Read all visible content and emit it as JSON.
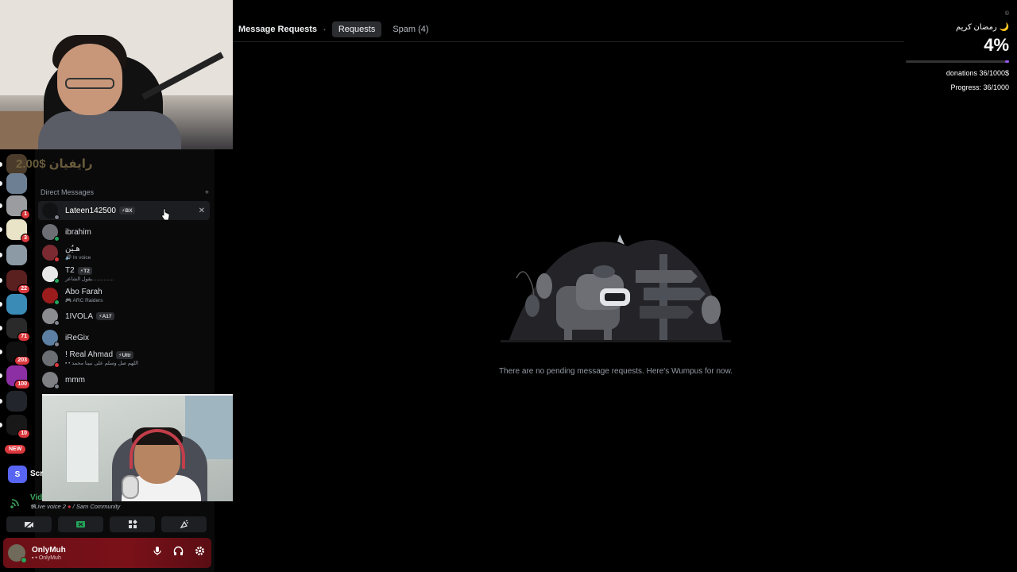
{
  "webcam_top": {},
  "topbar": {
    "title": "Message Requests",
    "tabs": [
      {
        "label": "Requests",
        "active": true
      },
      {
        "label": "Spam (4)",
        "active": false
      }
    ]
  },
  "widget": {
    "corner": "©",
    "arabic_title": "رمضان كريم 🌙",
    "percent": "4%",
    "progress_fraction": 0.036,
    "donations": "donations 36/1000$",
    "progress": "Progress: 36/1000"
  },
  "overlay_text": "2.00$ رايفيان",
  "dm": {
    "header": "Direct Messages",
    "add": "+",
    "items": [
      {
        "name": "Lateen142500",
        "tag": "⚡BX",
        "sub": "",
        "status_color": "#80848e",
        "avatar_color": "#111214",
        "selected": true
      },
      {
        "name": "ibrahim",
        "tag": "",
        "sub": "",
        "status_color": "#23a55a",
        "avatar_color": "#6d6f75"
      },
      {
        "name": "هـيُن",
        "tag": "",
        "sub": "🔊 In voice",
        "status_color": "#da373c",
        "avatar_color": "#7b2a31"
      },
      {
        "name": "T2",
        "tag": "⚡T2",
        "sub": "يقول الشاعر...............",
        "status_color": "#23a55a",
        "avatar_color": "#e8e8e8"
      },
      {
        "name": "Abo Farah",
        "tag": "",
        "sub": "🎮 ARC Raiders",
        "status_color": "#23a55a",
        "avatar_color": "#9b1c1c"
      },
      {
        "name": "1IVOLA",
        "tag": "⚡A17",
        "sub": "",
        "status_color": "#80848e",
        "avatar_color": "#8a8c90"
      },
      {
        "name": "iReGix",
        "tag": "",
        "sub": "",
        "status_color": "#80848e",
        "avatar_color": "#5c7fa3"
      },
      {
        "name": "! Real Ahmad",
        "tag": "⚡Ultr",
        "sub": "▪ • اللهم صل وسلم على نبينا محمد",
        "status_color": "#da373c",
        "avatar_color": "#6b6e72"
      },
      {
        "name": "mmm",
        "tag": "",
        "sub": "",
        "status_color": "#80848e",
        "avatar_color": "#7e8084"
      }
    ]
  },
  "servers": [
    {
      "color": "#4b3b2a",
      "badge": ""
    },
    {
      "color": "#6d7f92",
      "badge": ""
    },
    {
      "color": "#9a9ca0",
      "badge": "1"
    },
    {
      "color": "#e9e4c8",
      "badge": "3"
    },
    {
      "color": "#8c9aa6",
      "badge": ""
    },
    {
      "color": "#5a1f1f",
      "badge": "22"
    },
    {
      "color": "#3a8bb5",
      "badge": ""
    },
    {
      "color": "#2a2a2a",
      "badge": "71"
    },
    {
      "color": "#101010",
      "badge": "203"
    },
    {
      "color": "#8d2fa4",
      "badge": "100"
    },
    {
      "color": "#22252b",
      "badge": ""
    },
    {
      "color": "#181818",
      "badge": "10"
    }
  ],
  "new_badge": "NEW",
  "voice": {
    "server_letter": "S",
    "server_label": "Scr",
    "channel": "Vid",
    "line_prefix": "𝕭Live voice 2",
    "line_suffix": "/ Sam Community"
  },
  "user": {
    "name": "OnlyMuh",
    "sub": "▪ • OnlyMuh"
  },
  "empty_text": "There are no pending message requests. Here's Wumpus for now."
}
